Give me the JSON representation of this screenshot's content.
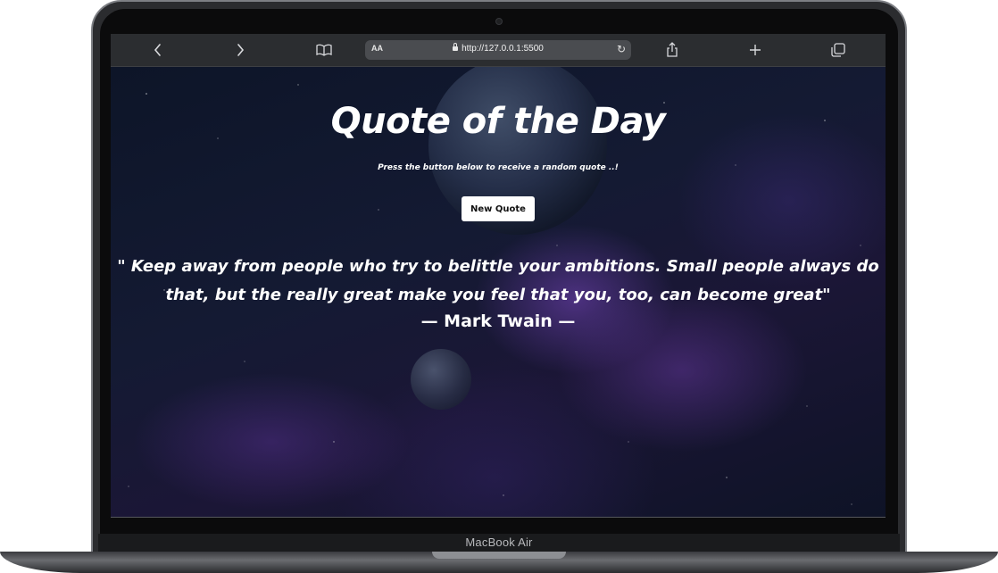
{
  "browser": {
    "text_size_label": "AA",
    "url": "http://127.0.0.1:5500",
    "icons": [
      "chevron-left-icon",
      "chevron-right-icon",
      "book-icon",
      "lock-icon",
      "reload-icon",
      "share-icon",
      "plus-icon",
      "tabs-icon"
    ]
  },
  "page": {
    "title": "Quote of the Day",
    "subtitle": "Press the button below to receive a random quote ..!",
    "button_label": "New Quote",
    "quote_text": "\" Keep away from people who try to belittle your ambitions. Small people always do that, but the really great make you feel that you, too, can become great\"",
    "author": "— Mark Twain —"
  },
  "device": {
    "model_name": "MacBook Air"
  },
  "colors": {
    "toolbar": "#2b2d30",
    "urlbar": "#4a4c50",
    "text": "#ffffff",
    "button_bg": "#ffffff"
  }
}
